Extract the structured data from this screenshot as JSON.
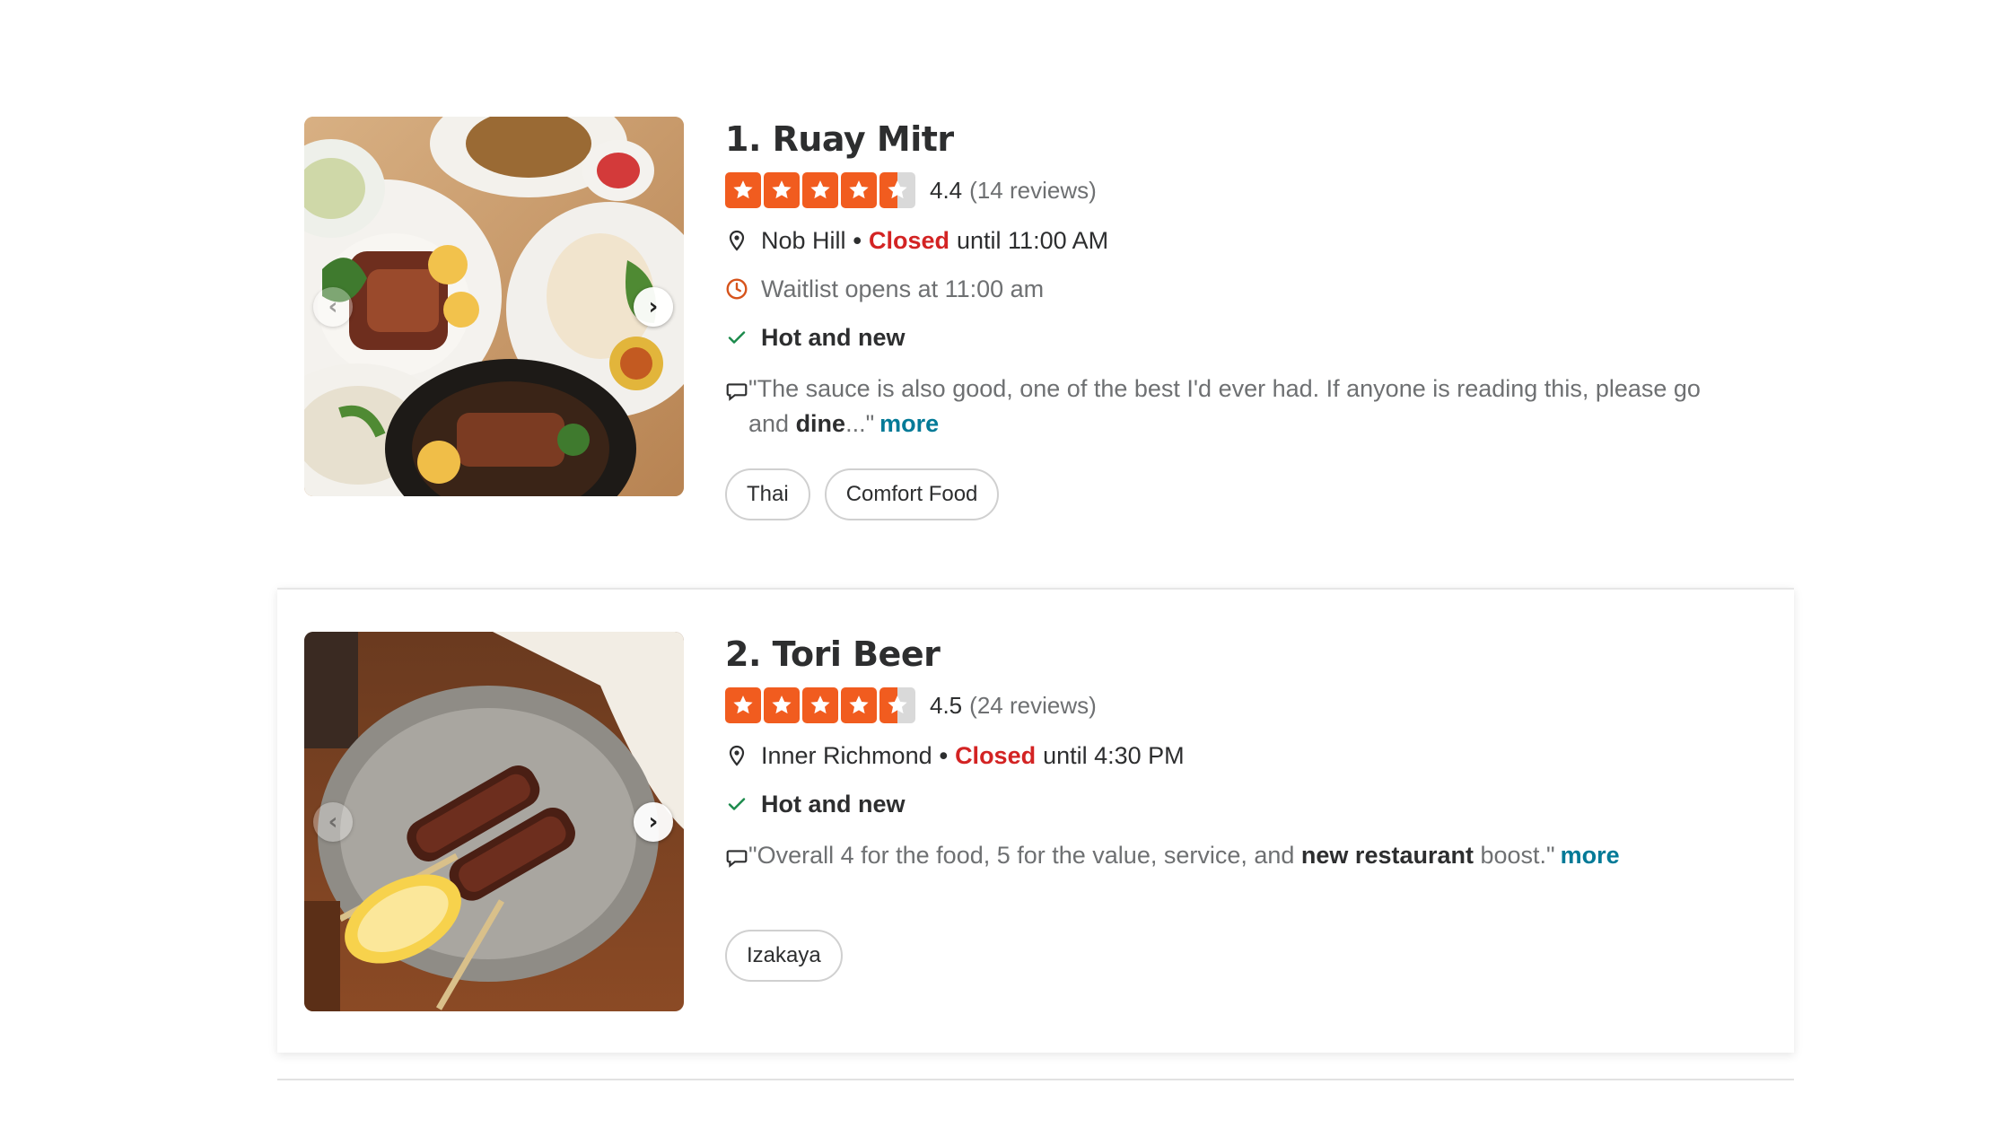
{
  "results": [
    {
      "name": "1. Ruay Mitr",
      "rating": "4.4",
      "rating_fraction": 0.88,
      "reviews": "(14 reviews)",
      "neighborhood": "Nob Hill",
      "separator": "•",
      "status": "Closed",
      "until": "until 11:00 AM",
      "waitlist": "Waitlist opens at 11:00 am",
      "badge": "Hot and new",
      "review_lead": "\"The sauce is also good, one of the best I'd ever had. If anyone is reading this, please go and ",
      "review_bold": "dine",
      "review_tail": "...\"",
      "more": "more",
      "tags": [
        "Thai",
        "Comfort Food"
      ]
    },
    {
      "name": "2. Tori Beer",
      "rating": "4.5",
      "rating_fraction": 0.9,
      "reviews": "(24 reviews)",
      "neighborhood": "Inner Richmond",
      "separator": "•",
      "status": "Closed",
      "until": "until 4:30 PM",
      "badge": "Hot and new",
      "review_lead": "\"Overall 4 for the food, 5 for the value, service, and ",
      "review_bold": "new restaurant",
      "review_tail": " boost.\"",
      "more": "more",
      "tags": [
        "Izakaya"
      ]
    }
  ],
  "colors": {
    "star": "#f15c1f",
    "closed": "#d32323",
    "link": "#027a97",
    "check": "#1b8a4b",
    "clock": "#d6531b"
  },
  "icons": [
    "map-pin-icon",
    "clock-icon",
    "checkmark-icon",
    "speech-bubble-icon",
    "chevron-left-icon",
    "chevron-right-icon",
    "star-icon"
  ]
}
